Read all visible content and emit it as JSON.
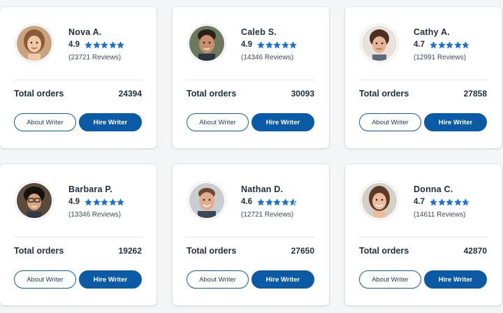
{
  "labels": {
    "total_orders": "Total orders",
    "about_button": "About Writer",
    "hire_button": "Hire Writer"
  },
  "colors": {
    "accent": "#0b5aa6",
    "star": "#1a73d1",
    "text": "#1f2d3d"
  },
  "icons": {
    "rating": "star-icon"
  },
  "writers": [
    {
      "name": "Nova A.",
      "rating": "4.9",
      "rating_value": 4.9,
      "reviews": "(23721 Reviews)",
      "total_orders": "24394"
    },
    {
      "name": "Caleb S.",
      "rating": "4.9",
      "rating_value": 4.9,
      "reviews": "(14346 Reviews)",
      "total_orders": "30093"
    },
    {
      "name": "Cathy A.",
      "rating": "4.7",
      "rating_value": 4.7,
      "reviews": "(12991 Reviews)",
      "total_orders": "27858"
    },
    {
      "name": "Barbara P.",
      "rating": "4.9",
      "rating_value": 4.9,
      "reviews": "(13346 Reviews)",
      "total_orders": "19262"
    },
    {
      "name": "Nathan D.",
      "rating": "4.6",
      "rating_value": 4.6,
      "reviews": "(12721 Reviews)",
      "total_orders": "27650"
    },
    {
      "name": "Donna C.",
      "rating": "4.7",
      "rating_value": 4.7,
      "reviews": "(14611 Reviews)",
      "total_orders": "42870"
    }
  ]
}
